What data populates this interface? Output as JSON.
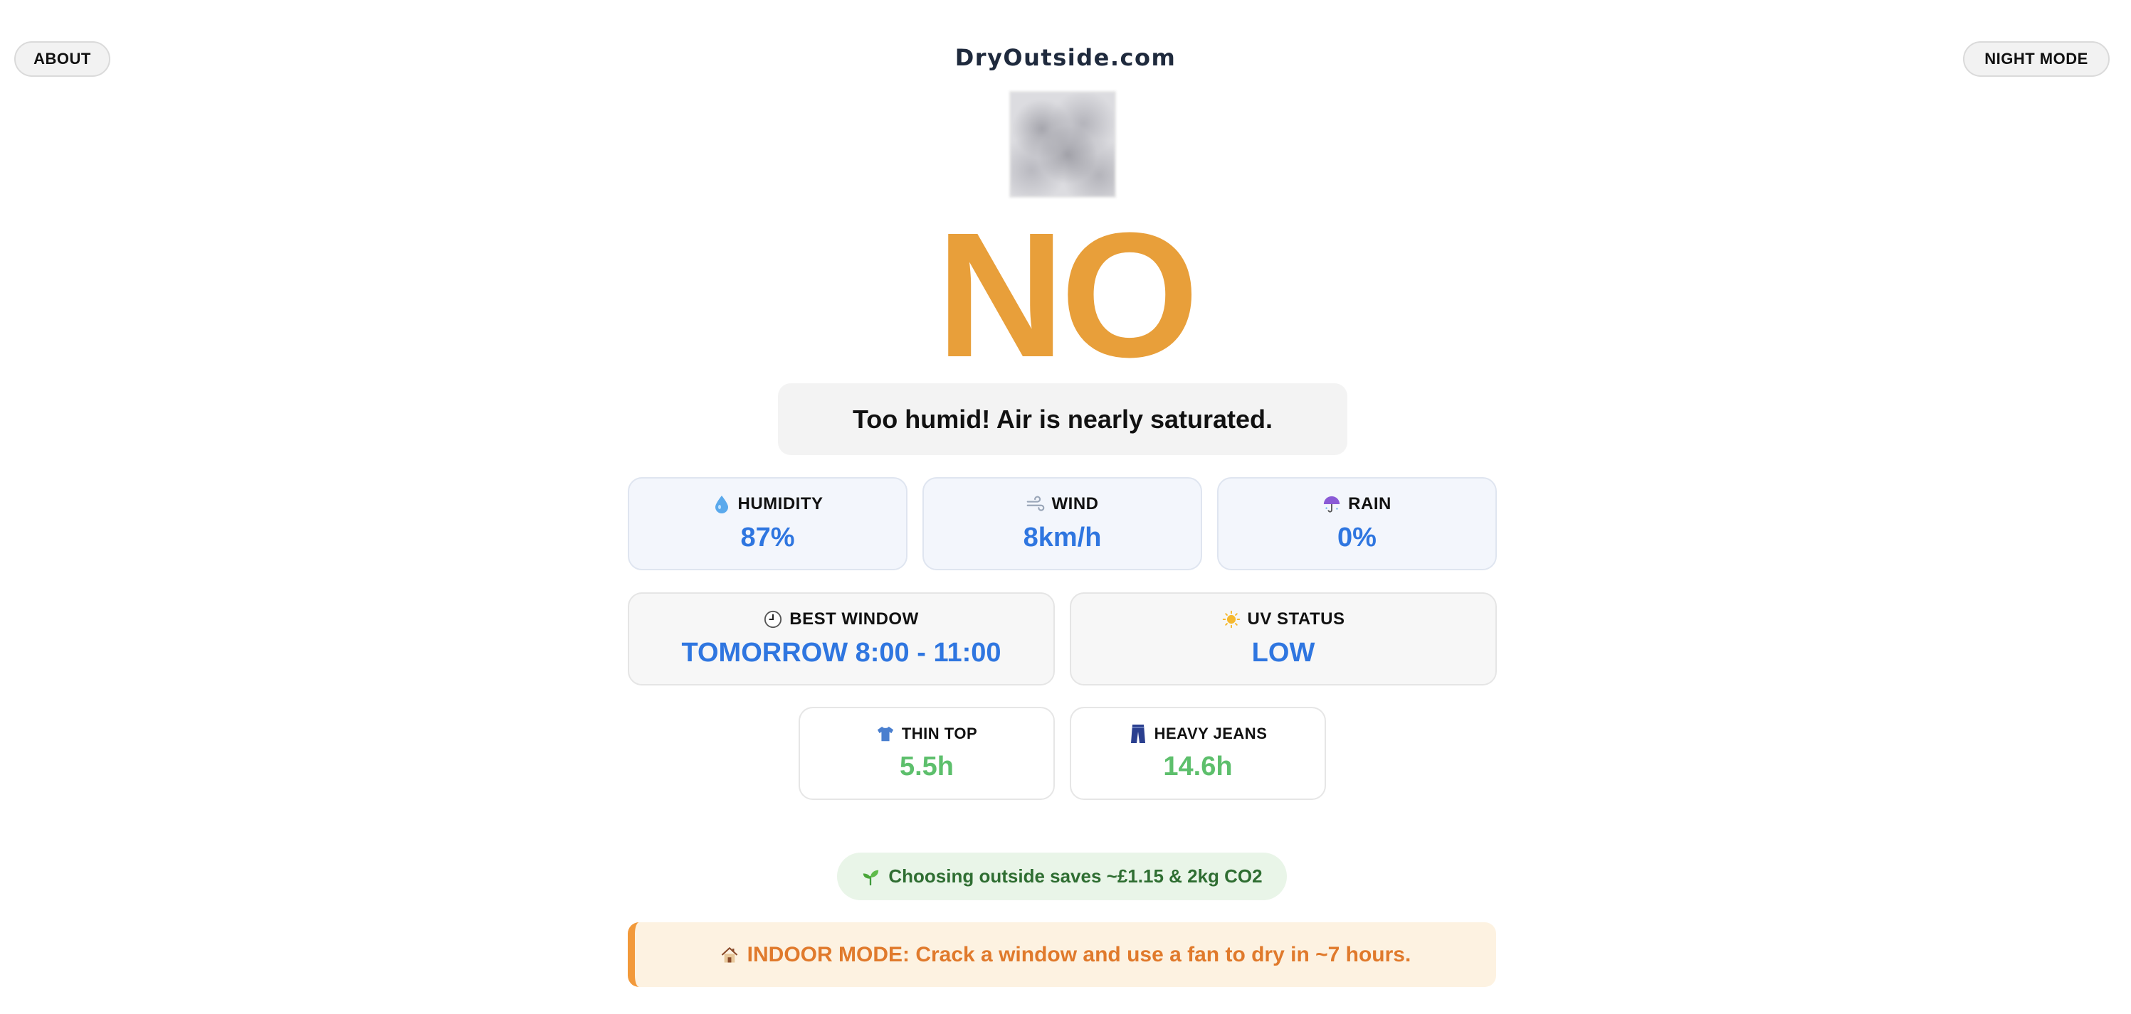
{
  "header": {
    "about_label": "ABOUT",
    "site_title": "DryOutside.com",
    "night_mode_label": "NIGHT MODE"
  },
  "verdict": {
    "answer": "NO",
    "answer_color": "#e89f3a",
    "message": "Too humid! Air is nearly saturated."
  },
  "conditions": [
    {
      "icon": "droplet-icon",
      "label": "HUMIDITY",
      "value": "87%"
    },
    {
      "icon": "wind-icon",
      "label": "WIND",
      "value": "8km/h"
    },
    {
      "icon": "umbrella-icon",
      "label": "RAIN",
      "value": "0%"
    }
  ],
  "forecast": {
    "best_window": {
      "icon": "clock-icon",
      "label": "BEST WINDOW",
      "value": "TOMORROW 8:00 - 11:00"
    },
    "uv_status": {
      "icon": "sun-icon",
      "label": "UV STATUS",
      "value": "LOW"
    }
  },
  "drying_times": [
    {
      "icon": "tshirt-icon",
      "label": "THIN TOP",
      "value": "5.5h"
    },
    {
      "icon": "jeans-icon",
      "label": "HEAVY JEANS",
      "value": "14.6h"
    }
  ],
  "eco": {
    "icon": "seedling-icon",
    "text": "Choosing outside saves ~£1.15 & 2kg CO2"
  },
  "indoor": {
    "icon": "house-icon",
    "text": "INDOOR MODE: Crack a window and use a fan to dry in ~7 hours."
  },
  "colors": {
    "accent_blue": "#2f76e0",
    "accent_green": "#5dbf6c",
    "indoor_orange": "#e07a2c"
  }
}
